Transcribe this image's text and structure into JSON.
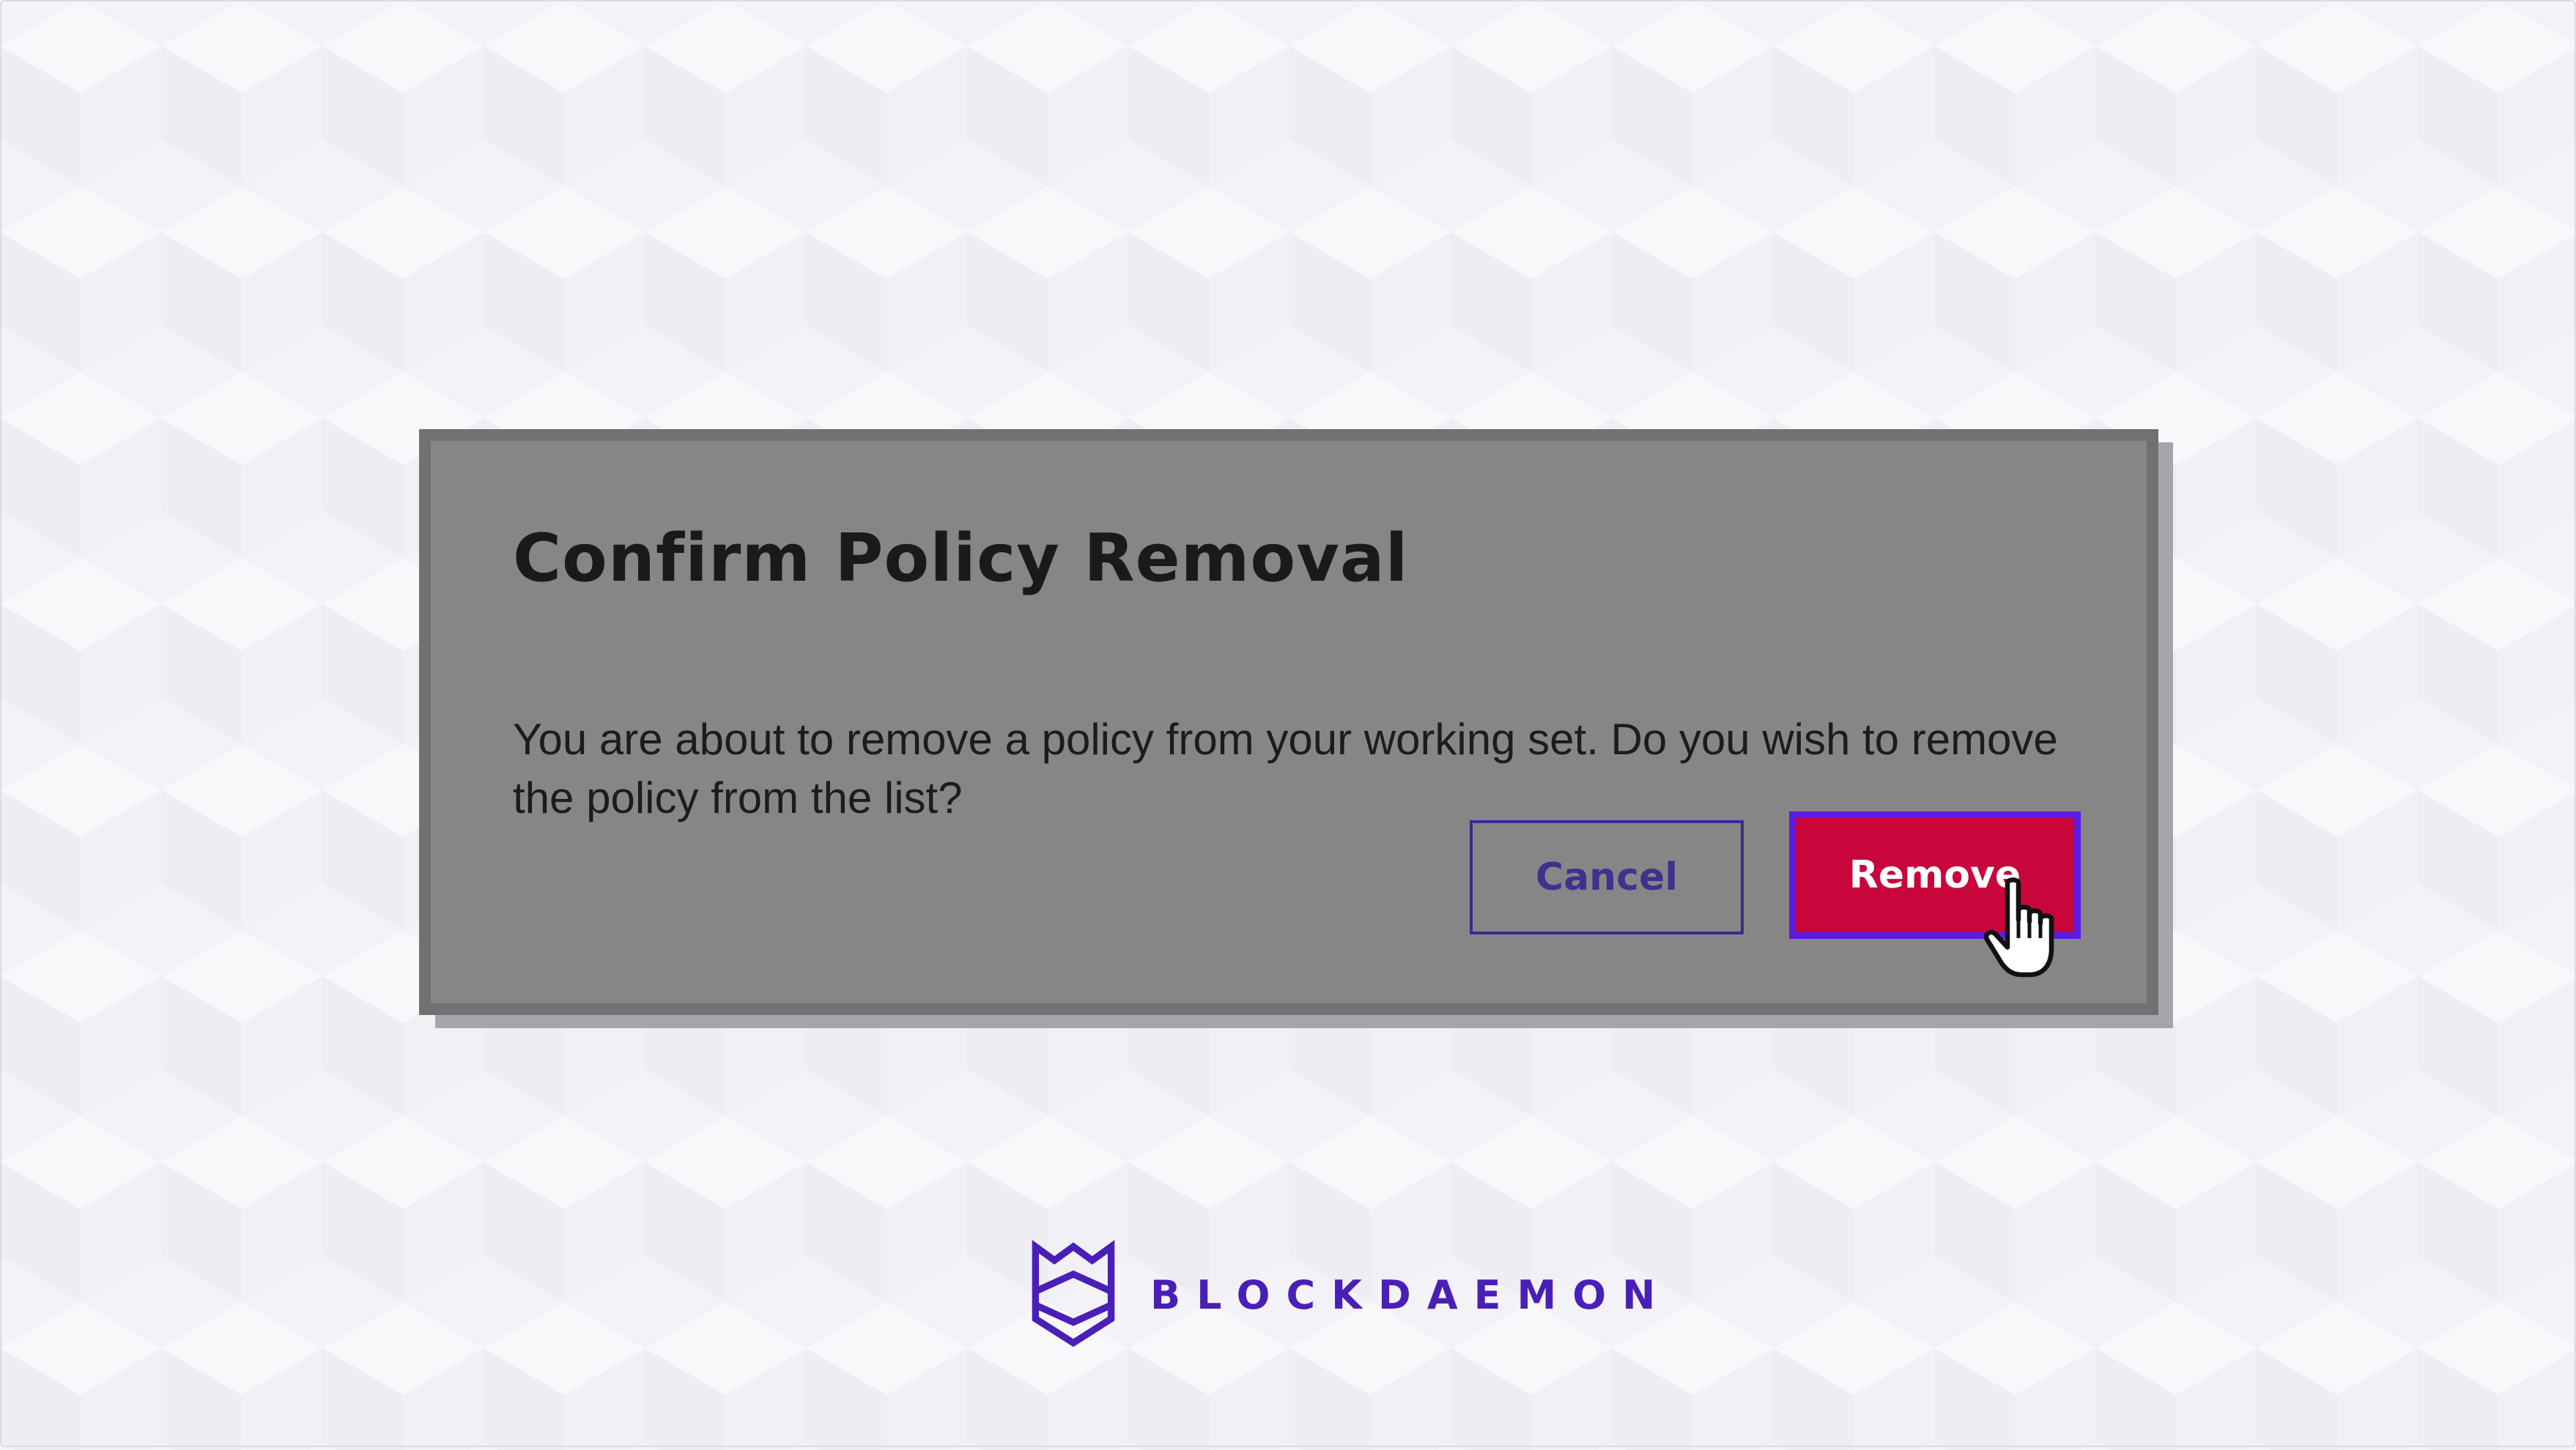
{
  "dialog": {
    "title": "Confirm Policy Removal",
    "message": "You are about to remove a policy from your working set. Do you wish to remove the policy from the list?",
    "cancel_label": "Cancel",
    "remove_label": "Remove"
  },
  "brand": {
    "name": "BLOCKDAEMON",
    "logo_icon": "blockdaemon-logo-icon"
  },
  "cursor": {
    "icon": "pointer-hand-icon"
  },
  "colors": {
    "remove_button": "#c8063c",
    "remove_button_focus_ring": "#5b1be0",
    "cancel_button_text": "#41308e",
    "brand_purple": "#4a1fb8",
    "dialog_background": "#878687"
  }
}
